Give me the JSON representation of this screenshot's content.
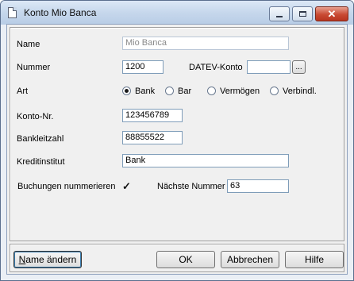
{
  "window": {
    "title": "Konto Mio Banca"
  },
  "form": {
    "name_label": "Name",
    "name_value": "Mio Banca",
    "nummer_label": "Nummer",
    "nummer_value": "1200",
    "datev_label": "DATEV-Konto",
    "datev_value": "",
    "datev_browse_label": "...",
    "art_label": "Art",
    "art_options": [
      "Bank",
      "Bar",
      "Vermögen",
      "Verbindl."
    ],
    "art_selected": "Bank",
    "kontonr_label": "Konto-Nr.",
    "kontonr_value": "123456789",
    "blz_label": "Bankleitzahl",
    "blz_value": "88855522",
    "kreditinstitut_label": "Kreditinstitut",
    "kreditinstitut_value": "Bank",
    "buchungen_label": "Buchungen nummerieren",
    "buchungen_checked": true,
    "naechste_label": "Nächste Nummer",
    "naechste_value": "63"
  },
  "buttons": {
    "rename_mnemonic": "N",
    "rename_rest": "ame ändern",
    "ok": "OK",
    "cancel": "Abbrechen",
    "help": "Hilfe"
  },
  "icons": {
    "window_icon": "document-icon",
    "minimize": "minimize-icon",
    "maximize": "maximize-icon",
    "close": "close-icon",
    "check": "checkmark-icon"
  }
}
